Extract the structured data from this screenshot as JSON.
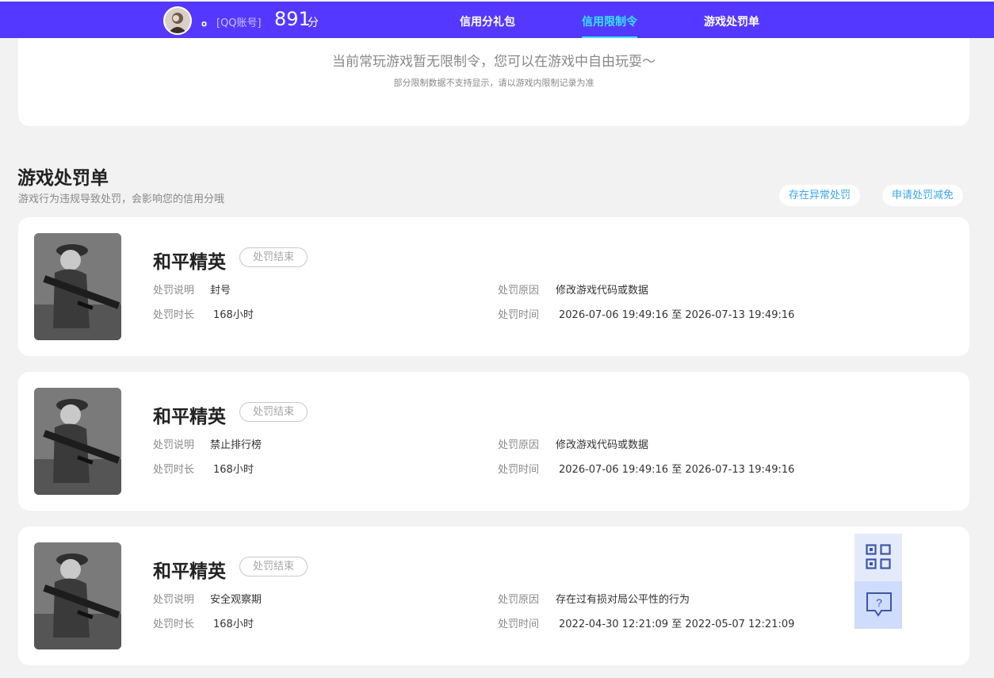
{
  "header": {
    "nickname": "。",
    "account_type": "[QQ账号]",
    "score": "891",
    "score_unit": "分",
    "tabs": [
      {
        "label": "信用分礼包",
        "active": false
      },
      {
        "label": "信用限制令",
        "active": true
      },
      {
        "label": "游戏处罚单",
        "active": false
      }
    ],
    "accent_color": "#5438ff",
    "active_tab_color": "#35e6ff"
  },
  "limit": {
    "message": "当前常玩游戏暂无限制令，您可以在游戏中自由玩耍～",
    "note": "部分限制数据不支持显示，请以游戏内限制记录为准"
  },
  "penalty": {
    "title": "游戏处罚单",
    "subtitle": "游戏行为违规导致处罚，会影响您的信用分哦",
    "abnormal_button": "存在异常处罚",
    "reduce_button": "申请处罚减免",
    "labels": {
      "desc": "处罚说明",
      "duration": "处罚时长",
      "reason": "处罚原因",
      "time": "处罚时间"
    },
    "items": [
      {
        "game": "和平精英",
        "status": "处罚结束",
        "desc": "封号",
        "duration": "168小时",
        "reason": "修改游戏代码或数据",
        "time": "2026-07-06 19:49:16 至 2026-07-13 19:49:16"
      },
      {
        "game": "和平精英",
        "status": "处罚结束",
        "desc": "禁止排行榜",
        "duration": "168小时",
        "reason": "修改游戏代码或数据",
        "time": "2026-07-06 19:49:16 至 2026-07-13 19:49:16"
      },
      {
        "game": "和平精英",
        "status": "处罚结束",
        "desc": "安全观察期",
        "duration": "168小时",
        "reason": "存在过有损对局公平性的行为",
        "time": "2022-04-30 12:21:09 至 2022-05-07 12:21:09"
      }
    ]
  },
  "float_panel": {
    "icons": [
      "qr-code-icon",
      "help-chat-icon"
    ]
  }
}
